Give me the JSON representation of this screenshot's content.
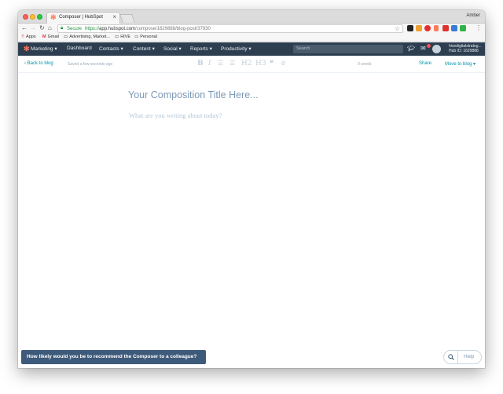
{
  "browser": {
    "tab_title": "Composer | HubSpot",
    "profile_name": "Amber",
    "secure_label": "Secure",
    "url_protocol": "https://",
    "url_host": "app.hubspot.com",
    "url_path": "/compose/1629888/blog-post/37930"
  },
  "bookmarks": [
    {
      "label": "Apps",
      "icon": "apps-grid-icon"
    },
    {
      "label": "Gmail",
      "icon": "gmail-icon"
    },
    {
      "label": "Advertising, Market...",
      "icon": "folder-icon"
    },
    {
      "label": "HIVE",
      "icon": "folder-icon"
    },
    {
      "label": "Personal",
      "icon": "folder-icon"
    }
  ],
  "hubspot_nav": {
    "marketing": "Marketing",
    "dashboard": "Dashboard",
    "contacts": "Contacts",
    "content": "Content",
    "social": "Social",
    "reports": "Reports",
    "productivity": "Productivity",
    "search_placeholder": "Search",
    "account_name": "hivedigitalstrateg...",
    "hub_id": "Hub ID: 1629888"
  },
  "composer": {
    "back_label": "Back to blog",
    "saved_status": "Saved a few seconds ago",
    "word_count": "0 words",
    "share_label": "Share",
    "move_label": "Move to blog",
    "format_buttons": [
      "B",
      "I",
      "H2",
      "H3"
    ]
  },
  "editor": {
    "title_placeholder": "Your Composition Title Here...",
    "body_placeholder": "What are you writing about today?"
  },
  "footer": {
    "survey_prompt": "How likely would you be to recommend the Composer to a colleague?",
    "help_label": "Help"
  },
  "colors": {
    "nav_bg": "#2d3e50",
    "link": "#0091ae",
    "hubspot_orange": "#ff7a59",
    "survey_bg": "#3e5a7a"
  }
}
